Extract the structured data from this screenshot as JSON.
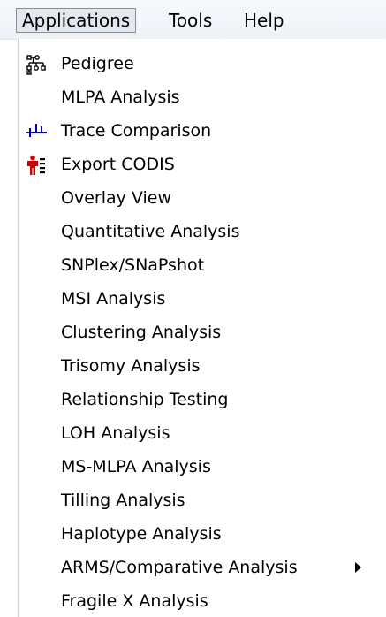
{
  "menubar": {
    "items": [
      {
        "label": "Applications",
        "active": true
      },
      {
        "label": "Tools",
        "active": false
      },
      {
        "label": "Help",
        "active": false
      }
    ]
  },
  "menu": {
    "items": [
      {
        "label": "Pedigree",
        "icon": "pedigree-icon"
      },
      {
        "label": "MLPA Analysis",
        "icon": null
      },
      {
        "label": "Trace Comparison",
        "icon": "trace-comparison-icon"
      },
      {
        "label": "Export CODIS",
        "icon": "export-codis-icon"
      },
      {
        "label": "Overlay View",
        "icon": null
      },
      {
        "label": "Quantitative Analysis",
        "icon": null
      },
      {
        "label": "SNPlex/SNaPshot",
        "icon": null
      },
      {
        "label": "MSI Analysis",
        "icon": null
      },
      {
        "label": "Clustering Analysis",
        "icon": null
      },
      {
        "label": "Trisomy Analysis",
        "icon": null
      },
      {
        "label": "Relationship Testing",
        "icon": null
      },
      {
        "label": "LOH Analysis",
        "icon": null
      },
      {
        "label": "MS-MLPA Analysis",
        "icon": null
      },
      {
        "label": "Tilling Analysis",
        "icon": null
      },
      {
        "label": "Haplotype Analysis",
        "icon": null
      },
      {
        "label": "ARMS/Comparative Analysis",
        "icon": null,
        "submenu": true
      },
      {
        "label": "Fragile X Analysis",
        "icon": null
      }
    ]
  },
  "colors": {
    "menubar_bg": "#eef2f8",
    "active_item_bg": "#e3e8ef",
    "trace_icon": "#0000cc",
    "codis_icon": "#cc0000"
  }
}
